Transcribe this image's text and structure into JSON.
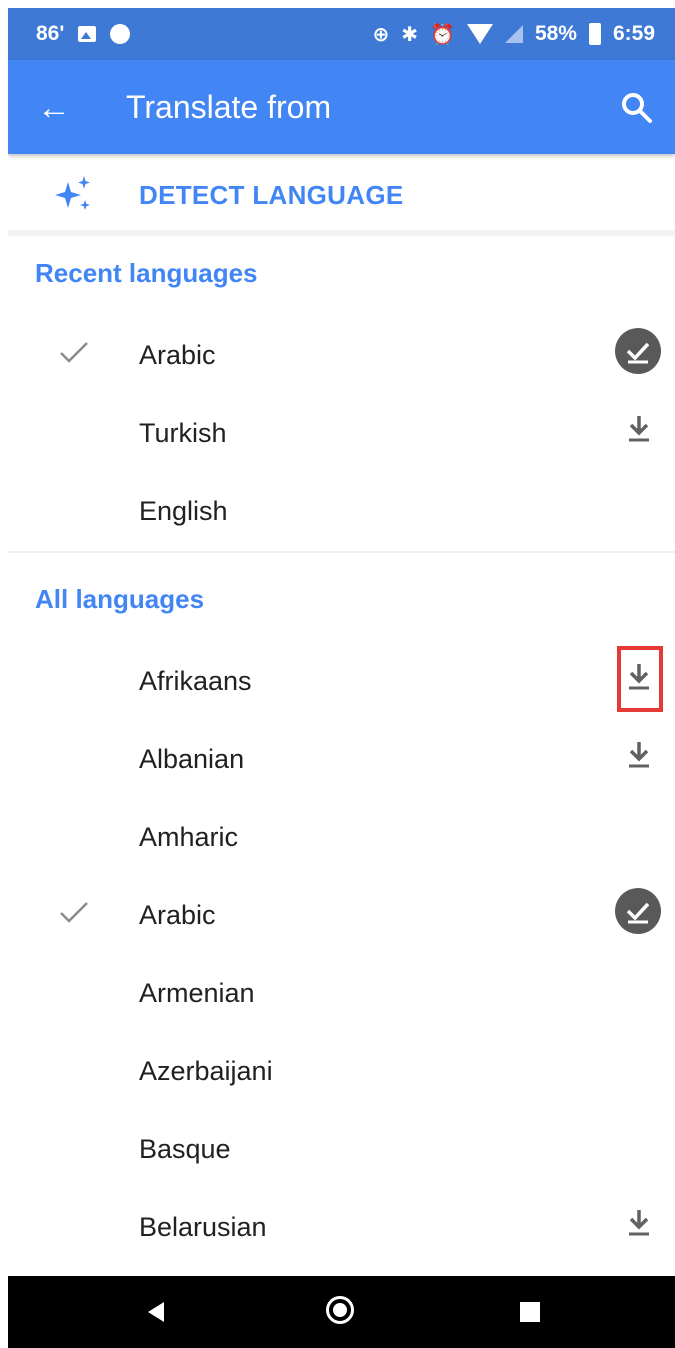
{
  "status_bar": {
    "temperature": "86'",
    "battery": "58%",
    "time": "6:59"
  },
  "app_bar": {
    "back_glyph": "←",
    "title": "Translate from"
  },
  "detect": {
    "label": "DETECT LANGUAGE"
  },
  "recent": {
    "header": "Recent languages",
    "items": [
      {
        "label": "Arabic",
        "selected": true,
        "status": "downloaded"
      },
      {
        "label": "Turkish",
        "selected": false,
        "status": "download"
      },
      {
        "label": "English",
        "selected": false,
        "status": "none"
      }
    ]
  },
  "all": {
    "header": "All languages",
    "items": [
      {
        "label": "Afrikaans",
        "selected": false,
        "status": "download",
        "highlighted": true
      },
      {
        "label": "Albanian",
        "selected": false,
        "status": "download"
      },
      {
        "label": "Amharic",
        "selected": false,
        "status": "none"
      },
      {
        "label": "Arabic",
        "selected": true,
        "status": "downloaded"
      },
      {
        "label": "Armenian",
        "selected": false,
        "status": "none"
      },
      {
        "label": "Azerbaijani",
        "selected": false,
        "status": "none"
      },
      {
        "label": "Basque",
        "selected": false,
        "status": "none"
      },
      {
        "label": "Belarusian",
        "selected": false,
        "status": "download"
      }
    ]
  },
  "colors": {
    "status_bar": "#3f79d6",
    "app_bar": "#4285f4",
    "accent": "#4285f4",
    "highlight": "#e53935"
  }
}
